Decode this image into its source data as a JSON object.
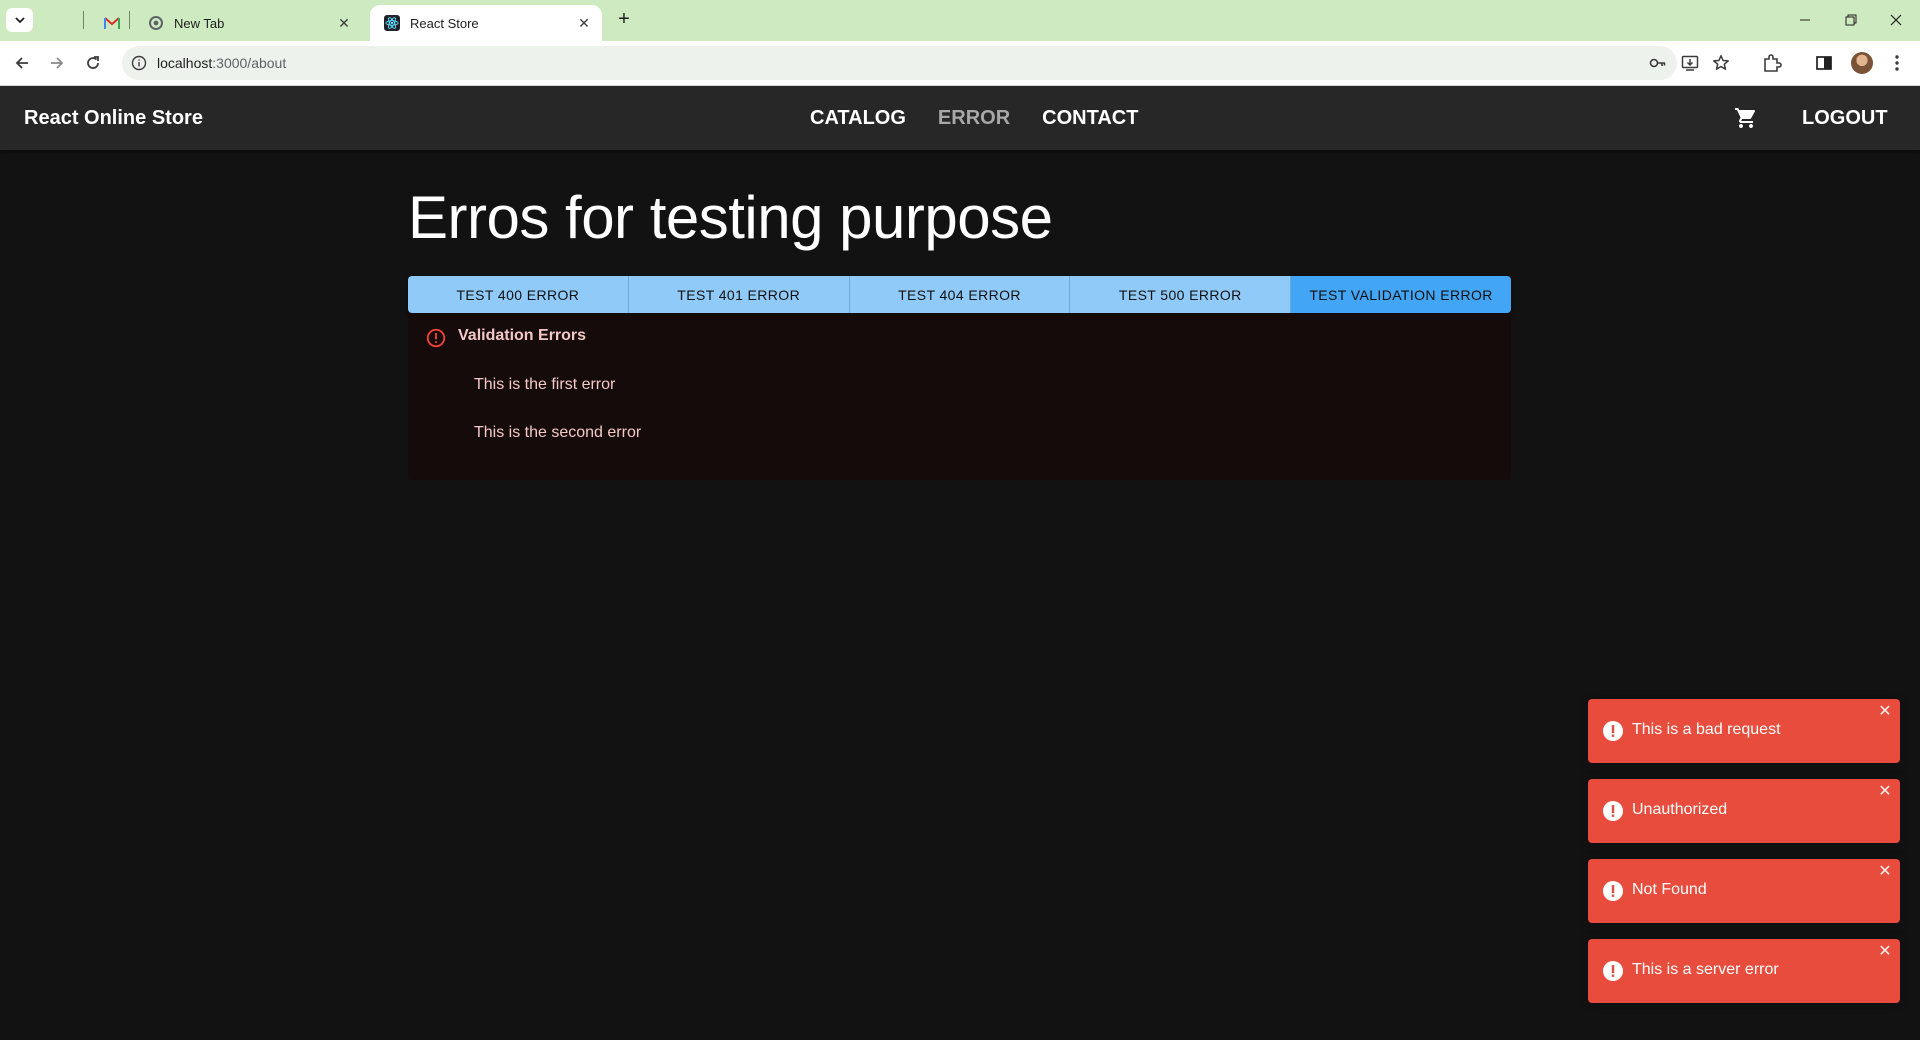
{
  "browser": {
    "tabs": [
      {
        "title": ""
      },
      {
        "title": "New Tab"
      },
      {
        "title": "React Store"
      }
    ],
    "url_host": "localhost",
    "url_path": ":3000/about"
  },
  "app": {
    "brand": "React Online Store",
    "nav": [
      "CATALOG",
      "ERROR",
      "CONTACT"
    ],
    "logout": "LOGOUT"
  },
  "main": {
    "title": "Erros for testing purpose",
    "buttons": [
      "TEST 400 ERROR",
      "TEST 401 ERROR",
      "TEST 404 ERROR",
      "TEST 500 ERROR",
      "TEST VALIDATION ERROR"
    ],
    "alert": {
      "title": "Validation Errors",
      "items": [
        "This is the first error",
        "This is the second error"
      ]
    }
  },
  "toasts": [
    {
      "message": "This is a bad request"
    },
    {
      "message": "Unauthorized"
    },
    {
      "message": "Not Found"
    },
    {
      "message": "This is a server error"
    }
  ],
  "colors": {
    "background": "#121212",
    "appbar": "#272727",
    "button": "#90caf9",
    "button_active": "#42a5f5",
    "toast": "#e74c3c",
    "alert_text": "#f4c7c7"
  }
}
